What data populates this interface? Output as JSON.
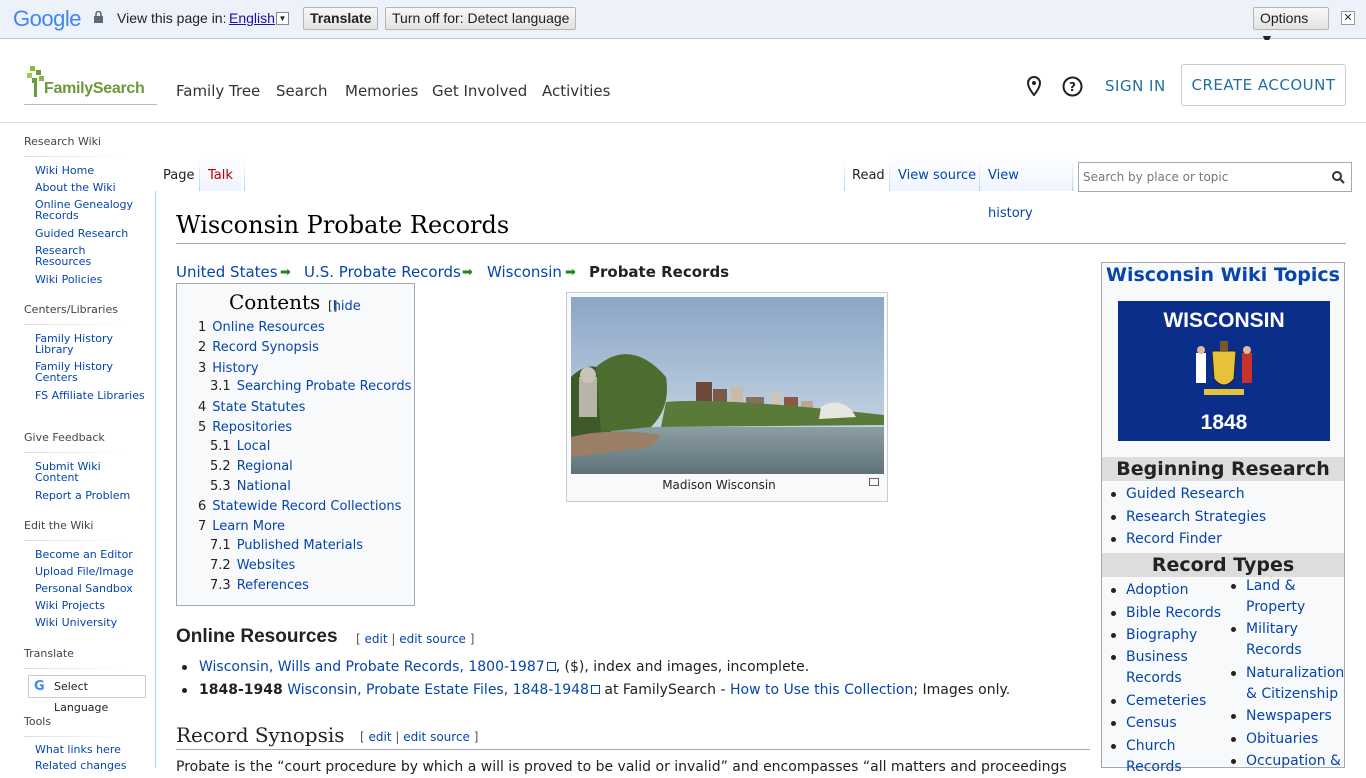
{
  "translate_bar": {
    "brand": "Google",
    "view_text": "View this page in:",
    "language": "English",
    "translate_label": "Translate",
    "turn_off_label": "Turn off for: Detect language",
    "options_label": "Options ▼",
    "close_label": "✕"
  },
  "header": {
    "logo_text": "FamilySearch",
    "nav": [
      "Family Tree",
      "Search",
      "Memories",
      "Get Involved",
      "Activities"
    ],
    "sign_in": "SIGN IN",
    "create_account": "CREATE ACCOUNT"
  },
  "sidebar": {
    "sections": [
      {
        "title": "Research Wiki",
        "items": [
          "Wiki Home",
          "About the Wiki",
          "Online Genealogy Records",
          "Guided Research",
          "Research Resources",
          "Wiki Policies"
        ]
      },
      {
        "title": "Centers/Libraries",
        "items": [
          "Family History Library",
          "Family History Centers",
          "FS Affiliate Libraries"
        ]
      },
      {
        "title": "Give Feedback",
        "items": [
          "Submit Wiki Content",
          "Report a Problem"
        ]
      },
      {
        "title": "Edit the Wiki",
        "items": [
          "Become an Editor",
          "Upload File/Image",
          "Personal Sandbox",
          "Wiki Projects",
          "Wiki University"
        ]
      },
      {
        "title": "Translate",
        "items": []
      },
      {
        "title": "Tools",
        "items": [
          "What links here",
          "Related changes"
        ]
      }
    ],
    "select_language": "Select Language"
  },
  "tabs": {
    "left": [
      "Page",
      "Talk"
    ],
    "right": [
      "Read",
      "View source",
      "View history"
    ],
    "search_placeholder": "Search by place or topic"
  },
  "page": {
    "title": "Wisconsin Probate Records",
    "breadcrumb": [
      "United States",
      "U.S. Probate Records",
      "Wisconsin",
      "Probate Records"
    ],
    "toc": {
      "title": "Contents",
      "hide": "hide",
      "items": [
        {
          "num": "1",
          "label": "Online Resources",
          "level": 1
        },
        {
          "num": "2",
          "label": "Record Synopsis",
          "level": 1
        },
        {
          "num": "3",
          "label": "History",
          "level": 1
        },
        {
          "num": "3.1",
          "label": "Searching Probate Records",
          "level": 2
        },
        {
          "num": "4",
          "label": "State Statutes",
          "level": 1
        },
        {
          "num": "5",
          "label": "Repositories",
          "level": 1
        },
        {
          "num": "5.1",
          "label": "Local",
          "level": 2
        },
        {
          "num": "5.2",
          "label": "Regional",
          "level": 2
        },
        {
          "num": "5.3",
          "label": "National",
          "level": 2
        },
        {
          "num": "6",
          "label": "Statewide Record Collections",
          "level": 1
        },
        {
          "num": "7",
          "label": "Learn More",
          "level": 1
        },
        {
          "num": "7.1",
          "label": "Published Materials",
          "level": 2
        },
        {
          "num": "7.2",
          "label": "Websites",
          "level": 2
        },
        {
          "num": "7.3",
          "label": "References",
          "level": 2
        }
      ]
    },
    "image_caption": "Madison Wisconsin",
    "online_resources": {
      "heading": "Online Resources",
      "edit": "edit",
      "edit_source": "edit source",
      "item1_link": "Wisconsin, Wills and Probate Records, 1800-1987",
      "item1_rest": ", ($), index and images, incomplete.",
      "item2_bold": "1848-1948",
      "item2_link": "Wisconsin, Probate Estate Files, 1848-1948",
      "item2_mid": " at FamilySearch - ",
      "item2_link2": "How to Use this Collection",
      "item2_rest": "; Images only."
    },
    "record_synopsis": {
      "heading": "Record Synopsis",
      "edit": "edit",
      "edit_source": "edit source",
      "text": "Probate is the “court procedure by which a will is proved to be valid or invalid” and encompasses “all matters and proceedings"
    }
  },
  "topics_box": {
    "title": "Wisconsin Wiki Topics",
    "flag_title": "WISCONSIN",
    "flag_year": "1848",
    "beginning_heading": "Beginning Research",
    "beginning": [
      "Guided Research",
      "Research Strategies",
      "Record Finder"
    ],
    "record_types_heading": "Record Types",
    "col1": [
      "Adoption",
      "Bible Records",
      "Biography",
      "Business Records",
      "Cemeteries",
      "Census",
      "Church Records"
    ],
    "col2": [
      "Land & Property",
      "Military Records",
      "Naturalization & Citizenship",
      "Newspapers",
      "Obituaries",
      "Occupation &"
    ]
  },
  "colors": {
    "link": "#0645ad",
    "fs_green": "#6a9a3a",
    "fs_blue": "#1f6fa5"
  }
}
